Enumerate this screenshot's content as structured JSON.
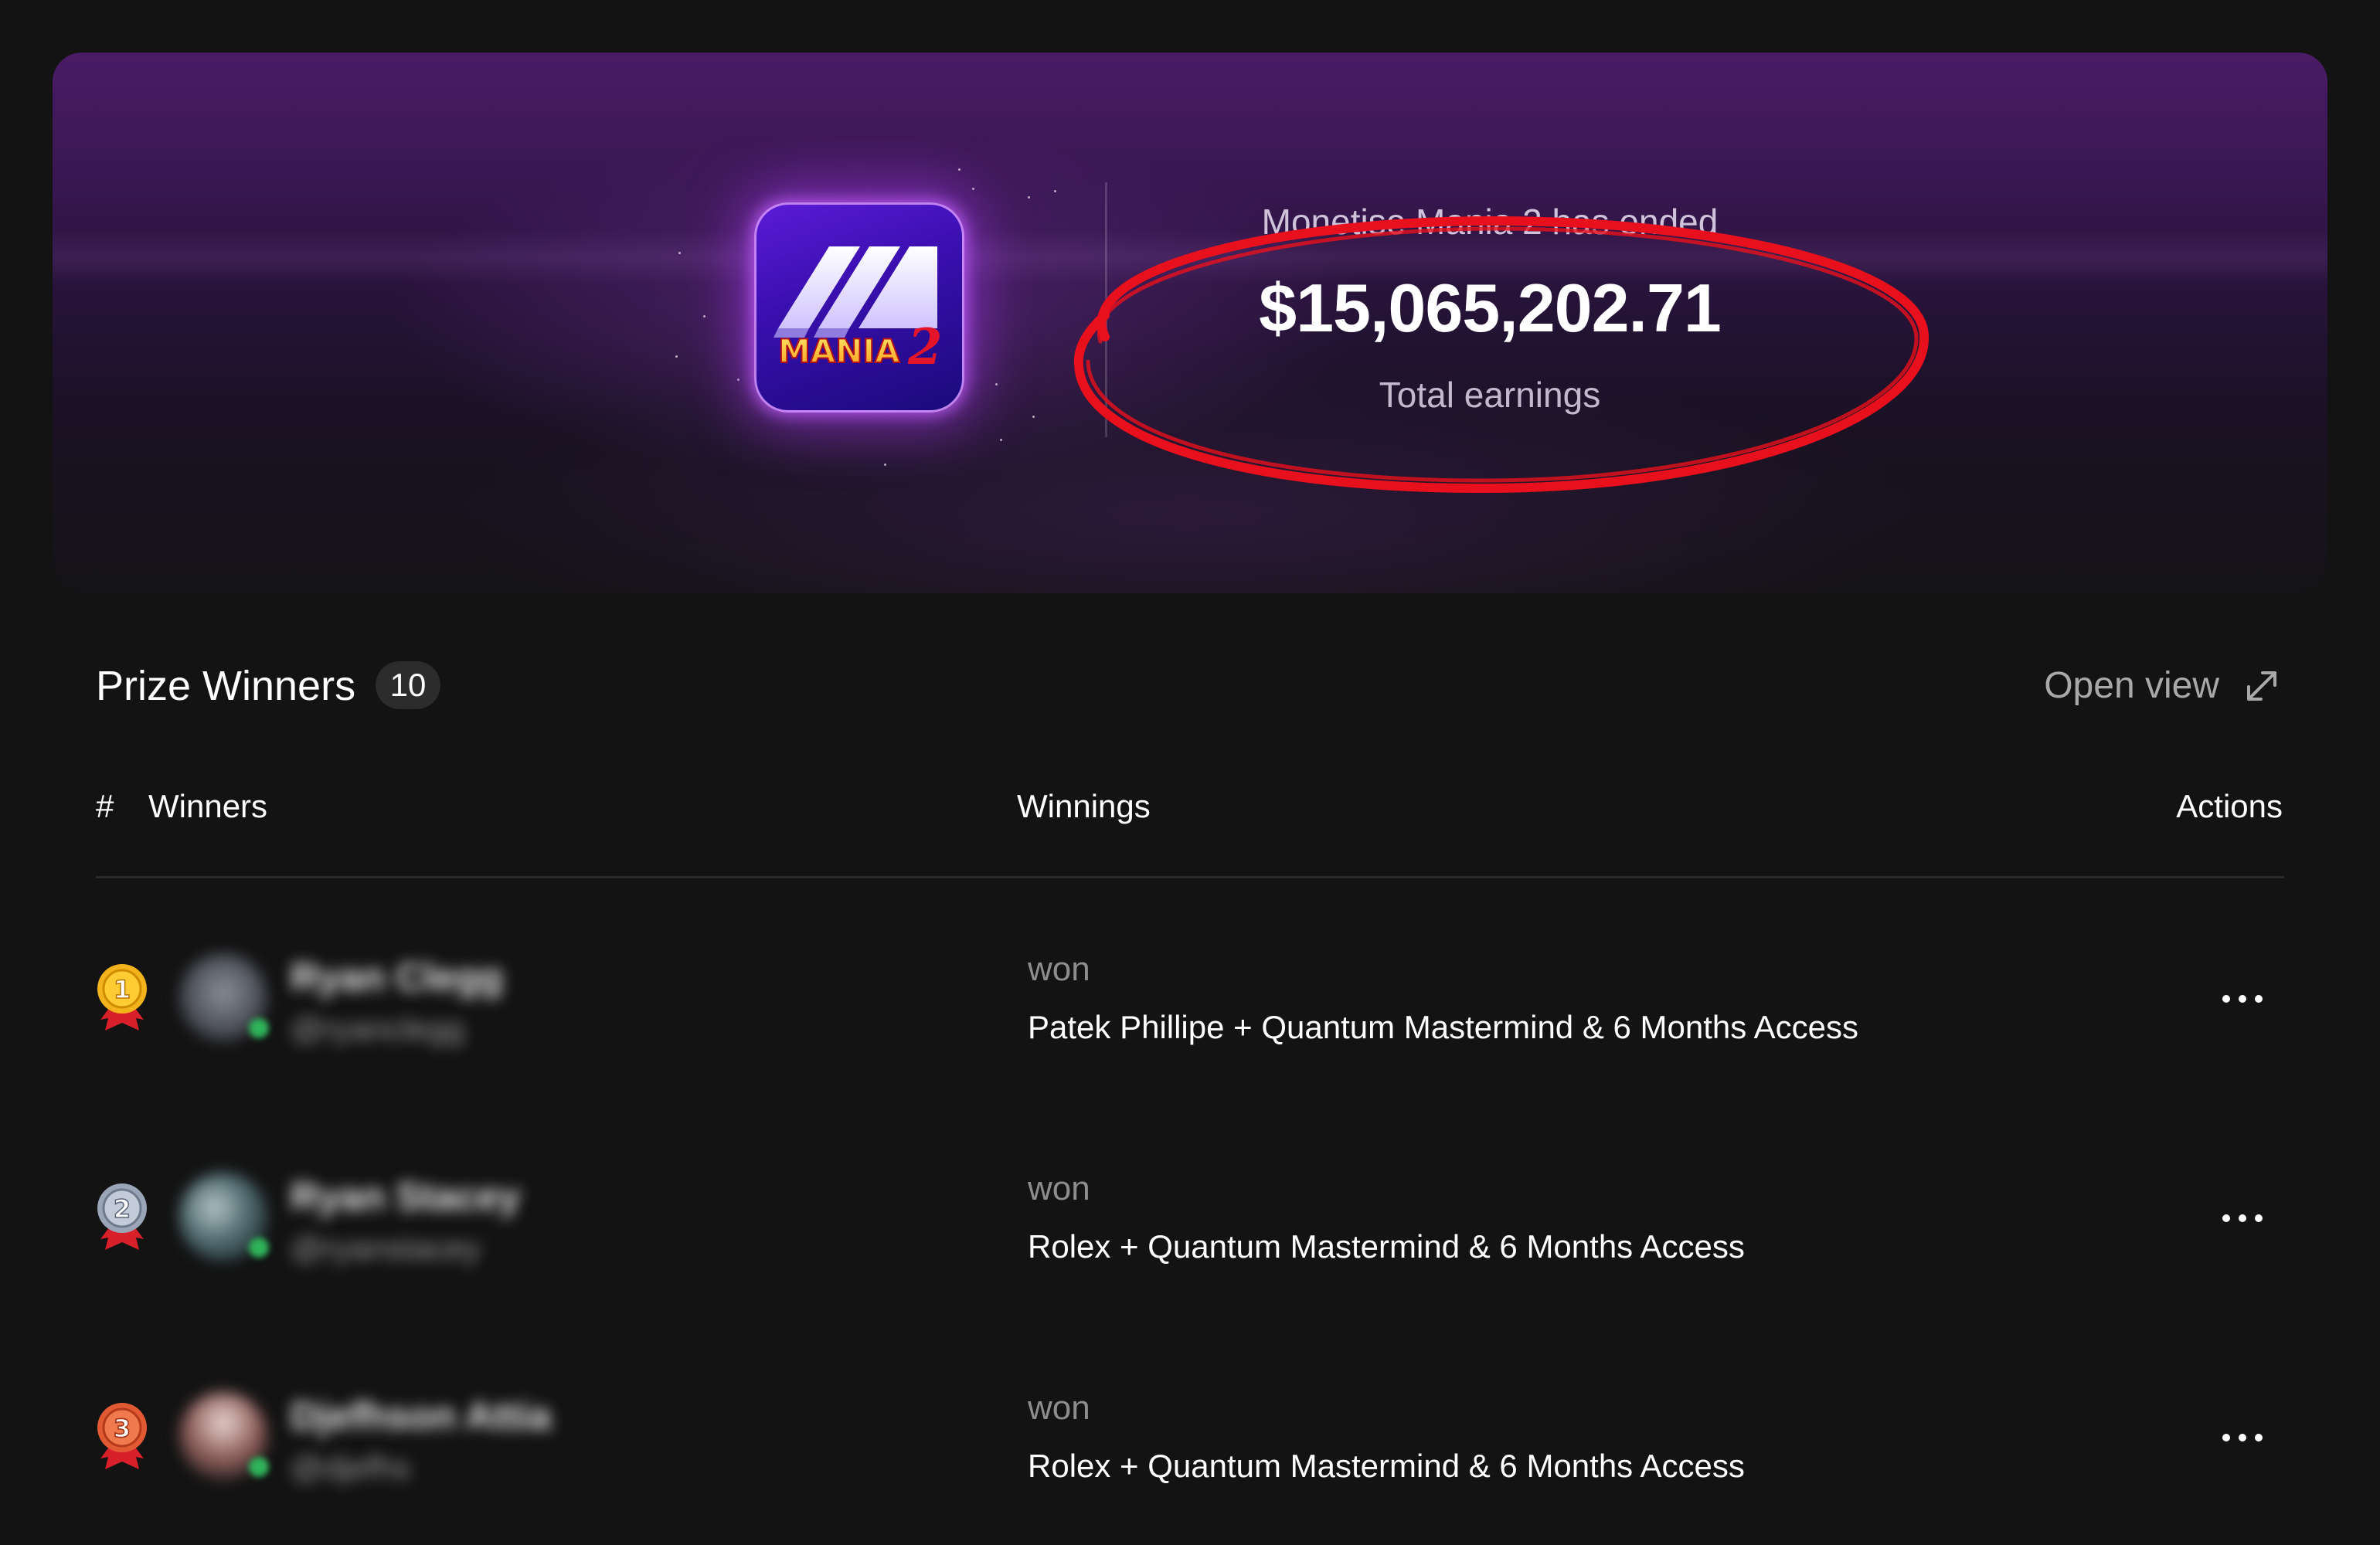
{
  "hero": {
    "app_icon_name": "monetise-mania-2-logo",
    "icon_text": "MANIA",
    "icon_number": "2",
    "subtitle": "Monetise Mania 2 has ended",
    "amount": "$15,065,202.71",
    "caption": "Total earnings",
    "annotation_color": "#e8101c"
  },
  "winners_section": {
    "title": "Prize Winners",
    "count": "10",
    "open_view_label": "Open view",
    "open_view_icon": "expand-arrows-icon"
  },
  "table": {
    "columns": {
      "rank": "#",
      "winners": "Winners",
      "winnings": "Winnings",
      "actions": "Actions"
    },
    "rows": [
      {
        "rank": "1",
        "medal_color": "#f2b31b",
        "name": "Ryan Clegg",
        "handle": "@ryanclegg",
        "won_label": "won",
        "prize": "Patek Phillipe + Quantum Mastermind & 6 Months Access"
      },
      {
        "rank": "2",
        "medal_color": "#9aa6b8",
        "name": "Ryan Stacey",
        "handle": "@ryanstacey",
        "won_label": "won",
        "prize": "Rolex + Quantum Mastermind & 6 Months Access"
      },
      {
        "rank": "3",
        "medal_color": "#e25a34",
        "name": "Djefhson Attia",
        "handle": "@djefhs",
        "won_label": "won",
        "prize": "Rolex + Quantum Mastermind & 6 Months Access"
      }
    ]
  },
  "colors": {
    "background": "#131313",
    "hero_purple": "#4a1c66",
    "muted_text": "#a9a9a9",
    "online": "#2fb35a",
    "ribbon": "#d8202a"
  }
}
